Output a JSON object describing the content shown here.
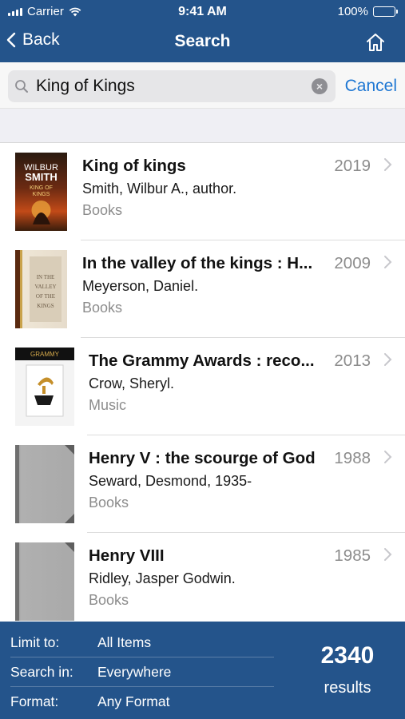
{
  "status_bar": {
    "carrier": "Carrier",
    "time": "9:41 AM",
    "battery": "100%"
  },
  "nav": {
    "back_label": "Back",
    "title": "Search"
  },
  "search": {
    "query": "King of Kings",
    "cancel_label": "Cancel"
  },
  "results": [
    {
      "title": "King of kings",
      "author": "Smith, Wilbur A., author.",
      "format": "Books",
      "year": "2019",
      "cover_text": [
        "WILBUR",
        "SMITH",
        "KING OF",
        "KINGS"
      ]
    },
    {
      "title": "In the valley of the kings : H...",
      "author": "Meyerson, Daniel.",
      "format": "Books",
      "year": "2009",
      "cover_text": [
        "IN THE",
        "VALLEY",
        "OF THE",
        "KINGS"
      ]
    },
    {
      "title": "The Grammy Awards : reco...",
      "author": "Crow, Sheryl.",
      "format": "Music",
      "year": "2013",
      "cover_text": [
        "GRAMMY"
      ]
    },
    {
      "title": "Henry V : the scourge of God",
      "author": "Seward, Desmond, 1935-",
      "format": "Books",
      "year": "1988"
    },
    {
      "title": "Henry VIII",
      "author": "Ridley, Jasper Godwin.",
      "format": "Books",
      "year": "1985"
    }
  ],
  "filters": [
    {
      "label": "Limit to:",
      "value": "All Items"
    },
    {
      "label": "Search in:",
      "value": "Everywhere"
    },
    {
      "label": "Format:",
      "value": "Any Format"
    }
  ],
  "summary": {
    "count": "2340",
    "label": "results"
  },
  "colors": {
    "brand_blue": "#24548b",
    "link_blue": "#1e77d3"
  },
  "icons": [
    "signal-icon",
    "wifi-icon",
    "battery-icon",
    "back-chevron-icon",
    "home-icon",
    "search-icon",
    "clear-icon",
    "chevron-right-icon"
  ]
}
